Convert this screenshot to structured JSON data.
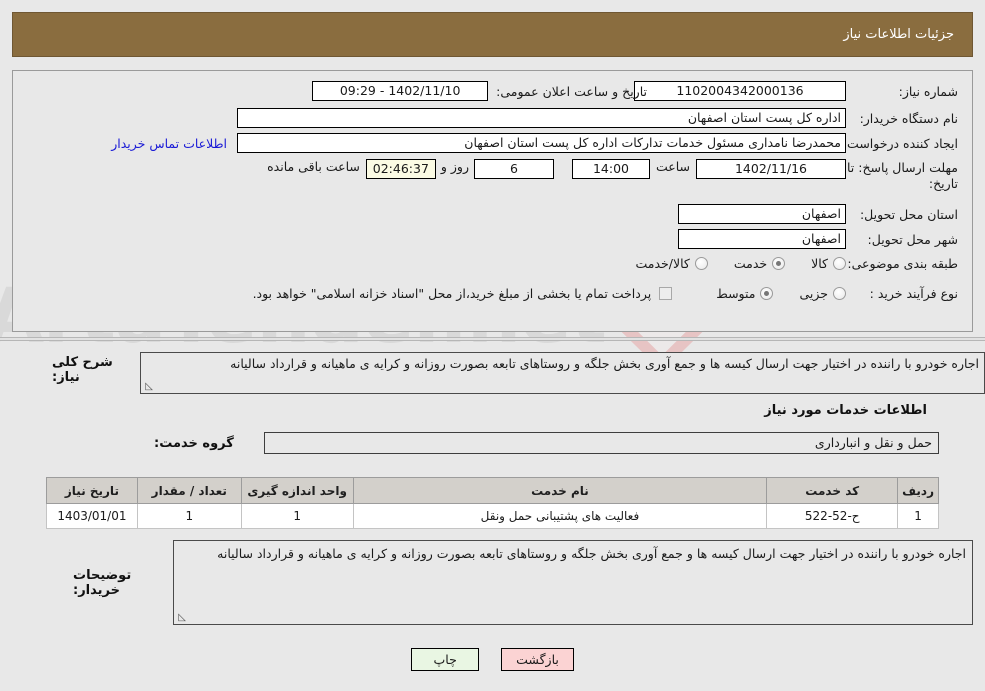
{
  "header": {
    "title": "جزئیات اطلاعات نیاز",
    "bar_color": "#8a6d3f"
  },
  "watermark": {
    "text": "ArtaTender.net",
    "icon": "shield-icon"
  },
  "form": {
    "need_number_label": "شماره نیاز:",
    "need_number_value": "1102004342000136",
    "announce_datetime_label": "تاریخ و ساعت اعلان عمومی:",
    "announce_datetime_value": "1402/11/10 - 09:29",
    "buyer_org_label": "نام دستگاه خریدار:",
    "buyer_org_value": "اداره کل پست استان اصفهان",
    "requester_label": "ایجاد کننده درخواست:",
    "requester_value": "محمدرضا نامداری مسئول خدمات تدارکات اداره کل پست استان اصفهان",
    "contact_link": "اطلاعات تماس خریدار",
    "deadline_label": "مهلت ارسال پاسخ: تا تاریخ:",
    "deadline_date": "1402/11/16",
    "deadline_hour_label": "ساعت",
    "deadline_hour_value": "14:00",
    "remaining_days_value": "6",
    "remaining_days_label": "روز و",
    "remaining_time_value": "02:46:37",
    "remaining_time_label": "ساعت باقی مانده",
    "delivery_province_label": "استان محل تحویل:",
    "delivery_province_value": "اصفهان",
    "delivery_city_label": "شهر محل تحویل:",
    "delivery_city_value": "اصفهان",
    "category_label": "طبقه بندی موضوعی:",
    "category_options": [
      {
        "label": "کالا",
        "selected": false
      },
      {
        "label": "خدمت",
        "selected": true
      },
      {
        "label": "کالا/خدمت",
        "selected": false
      }
    ],
    "process_label": "نوع فرآیند خرید :",
    "process_options": [
      {
        "label": "جزیی",
        "selected": false
      },
      {
        "label": "متوسط",
        "selected": true
      }
    ],
    "treasury_checkbox_checked": false,
    "treasury_note": "پرداخت تمام یا بخشی از مبلغ خرید،از محل \"اسناد خزانه اسلامی\" خواهد بود."
  },
  "need_description": {
    "label": "شرح کلی نیاز:",
    "value": "اجاره خودرو با راننده در اختیار جهت ارسال کیسه ها و جمع آوری بخش جلگه و روستاهای تابعه بصورت روزانه و کرایه ی ماهیانه و قرارداد سالیانه"
  },
  "services_section": {
    "heading": "اطلاعات خدمات مورد نیاز",
    "group_label": "گروه خدمت:",
    "group_value": "حمل و نقل و انبارداری"
  },
  "table": {
    "columns": [
      "ردیف",
      "کد خدمت",
      "نام خدمت",
      "واحد اندازه گیری",
      "تعداد / مقدار",
      "تاریخ نیاز"
    ],
    "rows": [
      {
        "row_no": "1",
        "service_code": "ح-52-522",
        "service_name": "فعالیت های پشتیبانی حمل ونقل",
        "unit": "1",
        "quantity": "1",
        "need_date": "1403/01/01"
      }
    ]
  },
  "buyer_notes": {
    "label": "توضیحات خریدار:",
    "value": "اجاره خودرو با راننده در اختیار جهت ارسال کیسه ها و جمع آوری بخش جلگه و روستاهای تابعه بصورت روزانه و کرایه ی ماهیانه و قرارداد سالیانه"
  },
  "footer": {
    "back_label": "بازگشت",
    "print_label": "چاپ",
    "back_color": "#fbd3d3",
    "print_color": "#e9f6e3"
  }
}
